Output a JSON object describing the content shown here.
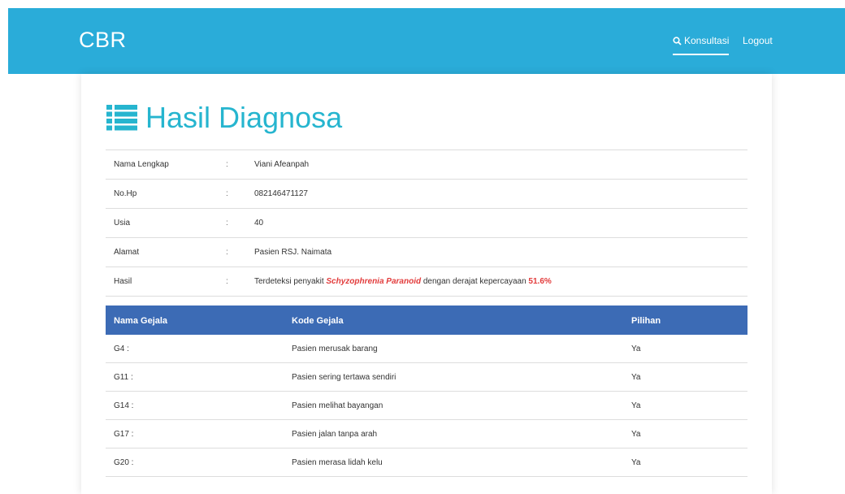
{
  "navbar": {
    "brand": "CBR",
    "konsultasi_label": "Konsultasi",
    "logout_label": "Logout",
    "background": "#2aacd9"
  },
  "page": {
    "title": "Hasil Diagnosa",
    "title_color": "#26b5cf",
    "title_icon": "list-icon"
  },
  "info": {
    "nama": {
      "label": "Nama Lengkap",
      "sep": ":",
      "value": "Viani Afeanpah"
    },
    "hp": {
      "label": "No.Hp",
      "sep": ":",
      "value": "082146471127"
    },
    "usia": {
      "label": "Usia",
      "sep": ":",
      "value": "40"
    },
    "alamat": {
      "label": "Alamat",
      "sep": ":",
      "value": "Pasien RSJ. Naimata"
    },
    "hasil": {
      "label": "Hasil",
      "sep": ":",
      "prefix": "Terdeteksi penyakit",
      "disease": "Schyzophrenia Paranoid",
      "middle": "dengan derajat kepercayaan",
      "confidence": "51.6%"
    }
  },
  "symptoms": {
    "header_color": "#3c6bb5",
    "headers": {
      "nama": "Nama Gejala",
      "kode": "Kode Gejala",
      "pilihan": "Pilihan"
    },
    "rows": [
      {
        "code": "G4 :",
        "desc": "Pasien merusak barang",
        "choice": "Ya"
      },
      {
        "code": "G11 :",
        "desc": "Pasien sering tertawa sendiri",
        "choice": "Ya"
      },
      {
        "code": "G14 :",
        "desc": "Pasien melihat bayangan",
        "choice": "Ya"
      },
      {
        "code": "G17 :",
        "desc": "Pasien jalan tanpa arah",
        "choice": "Ya"
      },
      {
        "code": "G20 :",
        "desc": "Pasien merasa lidah kelu",
        "choice": "Ya"
      }
    ]
  }
}
